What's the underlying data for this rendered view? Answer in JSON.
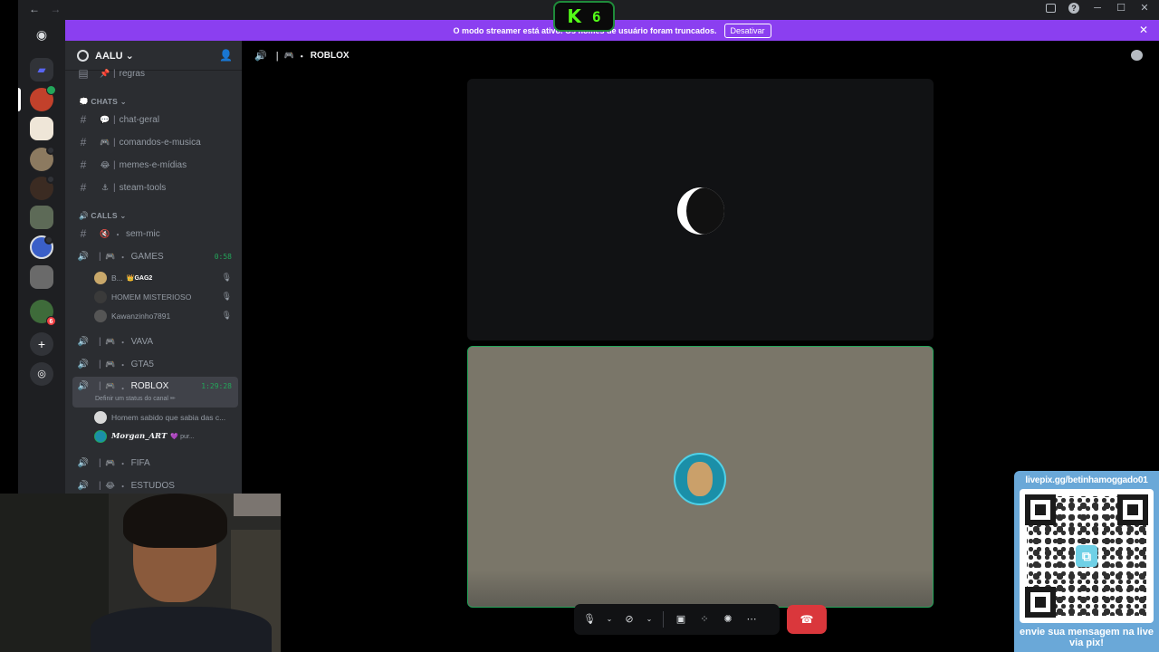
{
  "titlebar": {
    "back": "←",
    "forward": "→",
    "minimize": "─",
    "maximize": "☐",
    "close": "✕"
  },
  "banner": {
    "text": "O modo streamer está ativo. Os nomes de usuário foram truncados.",
    "button": "Desativar",
    "close": "✕"
  },
  "kick_overlay": {
    "logo": "K",
    "count": "6"
  },
  "server": {
    "name": "AALU",
    "chevron": "⌄"
  },
  "channels": {
    "regras": {
      "emoji": "📌",
      "name": "regras"
    },
    "cat_chats": "CHATS",
    "chat_geral": {
      "emoji": "💬",
      "name": "chat-geral"
    },
    "comandos": {
      "emoji": "🎮",
      "name": "comandos-e-musica"
    },
    "memes": {
      "emoji": "😂",
      "name": "memes-e-mídias"
    },
    "steam": {
      "emoji": "⚓",
      "name": "steam-tools"
    },
    "cat_calls": "CALLS",
    "sem_mic": {
      "emoji": "🔇",
      "name": "sem-mic"
    },
    "games": {
      "name": "GAMES",
      "timer": "0:58"
    },
    "games_users": [
      {
        "name": "B...",
        "tag": "GAG2"
      },
      {
        "name": "HOMEM MISTERIOSO"
      },
      {
        "name": "Kawanzinho7891"
      }
    ],
    "vava": {
      "name": "VAVA"
    },
    "gta5": {
      "name": "GTA5"
    },
    "roblox": {
      "name": "ROBLOX",
      "timer": "1:29:28",
      "status": "Definir um status do canal"
    },
    "roblox_users": [
      {
        "name": "Homem sabido que sabia das c..."
      },
      {
        "name": "𝑴𝒐𝒓𝒈𝒂𝒏_𝑨𝑹𝑻",
        "extra": "💜 pur..."
      }
    ],
    "fifa": {
      "name": "FIFA"
    },
    "estudos": {
      "emoji": "😂",
      "name": "ESTUDOS"
    },
    "sep": "|",
    "dot": "・"
  },
  "main": {
    "title": "ROBLOX"
  },
  "livepix": {
    "url": "livepix.gg/betinhamoggado01",
    "message": "envie sua mensagem na live via pix!"
  },
  "colors": {
    "banner": "#8b3ff0",
    "speaking": "#23a55a",
    "hangup": "#da373c",
    "kick": "#53fc18"
  }
}
